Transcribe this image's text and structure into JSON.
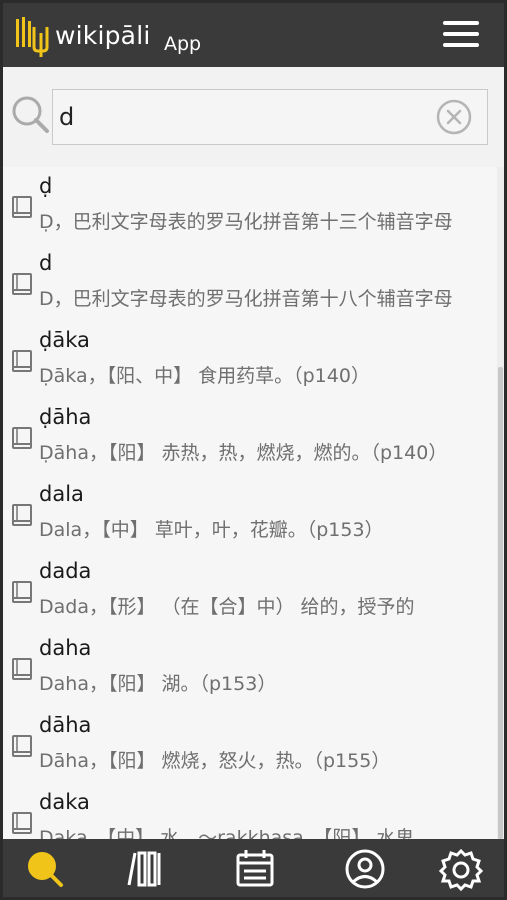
{
  "header": {
    "brand": "wikipāli",
    "brand_sub": "App"
  },
  "search": {
    "value": "d",
    "placeholder": ""
  },
  "results": [
    {
      "term": "ḍ",
      "meaning": "Ḍ，巴利文字母表的罗马化拼音第十三个辅音字母"
    },
    {
      "term": "d",
      "meaning": "D，巴利文字母表的罗马化拼音第十八个辅音字母"
    },
    {
      "term": "ḍāka",
      "meaning": "Ḍāka，【阳、中】 食用药草。（p140）"
    },
    {
      "term": "ḍāha",
      "meaning": "Ḍāha，【阳】 赤热，热，燃烧，燃的。（p140）"
    },
    {
      "term": "dala",
      "meaning": "Dala，【中】 草叶，叶，花瓣。（p153）"
    },
    {
      "term": "dada",
      "meaning": "Dada，【形】 （在【合】中） 给的，授予的"
    },
    {
      "term": "daha",
      "meaning": "Daha，【阳】 湖。（p153）"
    },
    {
      "term": "dāha",
      "meaning": "Dāha，【阳】 燃烧，怒火，热。（p155）"
    },
    {
      "term": "daka",
      "meaning": "Daka，【中】 水。～rakkhasa，【阳】 水鬼"
    }
  ],
  "tabs": [
    {
      "name": "search",
      "icon": "search-icon",
      "active": true
    },
    {
      "name": "library",
      "icon": "library-icon",
      "active": false
    },
    {
      "name": "calendar",
      "icon": "calendar-icon",
      "active": false
    },
    {
      "name": "profile",
      "icon": "user-icon",
      "active": false
    },
    {
      "name": "settings",
      "icon": "gear-icon",
      "active": false
    }
  ],
  "colors": {
    "header_bg": "#3a3a3a",
    "accent": "#f0c419",
    "icon_light": "#ffffff",
    "meaning_text": "#6f6f6f"
  }
}
